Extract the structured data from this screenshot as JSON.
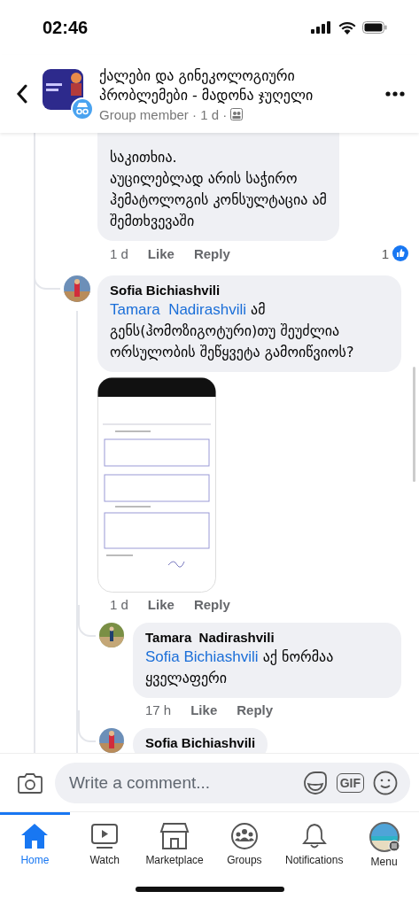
{
  "status_bar": {
    "time": "02:46"
  },
  "header": {
    "title": "ქალები და გინეკოლოგიური პრობლემები - მადონა ჯუღელი",
    "subtitle": "Group member · 1 d ·"
  },
  "replies": [
    {
      "text": "საკითხია.\nაუცილებლად არის საჭირო\nჰემატოლოგის კონსულტაცია ამ\nშემთხვევაში",
      "time": "1 d",
      "like": "Like",
      "reply": "Reply",
      "reaction_count": "1"
    },
    {
      "author": "Sofia Bichiashvili",
      "mention": "Tamara  Nadirashvili",
      "text": "ამ გენს(ჰომოზიგოტური)თუ შეუძლია ორსულობის შეწყვეტა გამოიწვიოს?",
      "time": "1 d",
      "like": "Like",
      "reply": "Reply",
      "children": [
        {
          "author": "Tamara  Nadirashvili",
          "mention": "Sofia Bichiashvili",
          "text": "აქ ნორმაა ყველაფერი",
          "time": "17 h",
          "like": "Like",
          "reply": "Reply"
        },
        {
          "author": "Sofia Bichiashvili"
        }
      ]
    }
  ],
  "composer": {
    "placeholder": "Write a comment...",
    "gif": "GIF"
  },
  "tabs": [
    {
      "label": "Home",
      "selected": true
    },
    {
      "label": "Watch",
      "selected": false
    },
    {
      "label": "Marketplace",
      "selected": false
    },
    {
      "label": "Groups",
      "selected": false
    },
    {
      "label": "Notifications",
      "selected": false
    },
    {
      "label": "Menu",
      "selected": false
    }
  ]
}
